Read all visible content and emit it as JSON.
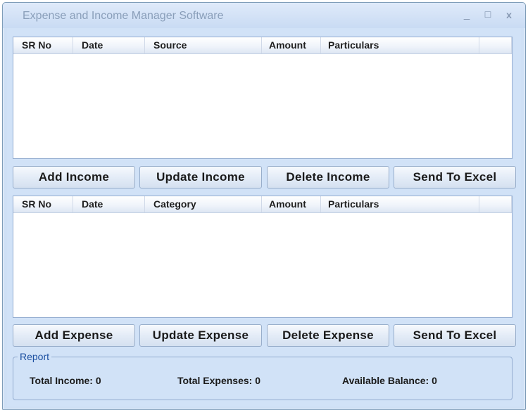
{
  "window": {
    "title": "Expense and Income Manager Software",
    "minimize_glyph": "_",
    "maximize_glyph": "☐",
    "close_glyph": "x"
  },
  "income_list": {
    "columns": [
      "SR No",
      "Date",
      "Source",
      "Amount",
      "Particulars",
      ""
    ],
    "rows": []
  },
  "income_buttons": {
    "add": "Add Income",
    "update": "Update Income",
    "delete": "Delete Income",
    "export": "Send To Excel"
  },
  "expense_list": {
    "columns": [
      "SR No",
      "Date",
      "Category",
      "Amount",
      "Particulars",
      ""
    ],
    "rows": []
  },
  "expense_buttons": {
    "add": "Add Expense",
    "update": "Update Expense",
    "delete": "Delete Expense",
    "export": "Send To Excel"
  },
  "report": {
    "legend": "Report",
    "total_income": "Total Income: 0",
    "total_expenses": "Total Expenses: 0",
    "available_balance": "Available Balance: 0"
  },
  "colors": {
    "window_bg": "#d1e2f7",
    "title_text": "#8a9fba",
    "legend_text": "#1b4fa0"
  }
}
